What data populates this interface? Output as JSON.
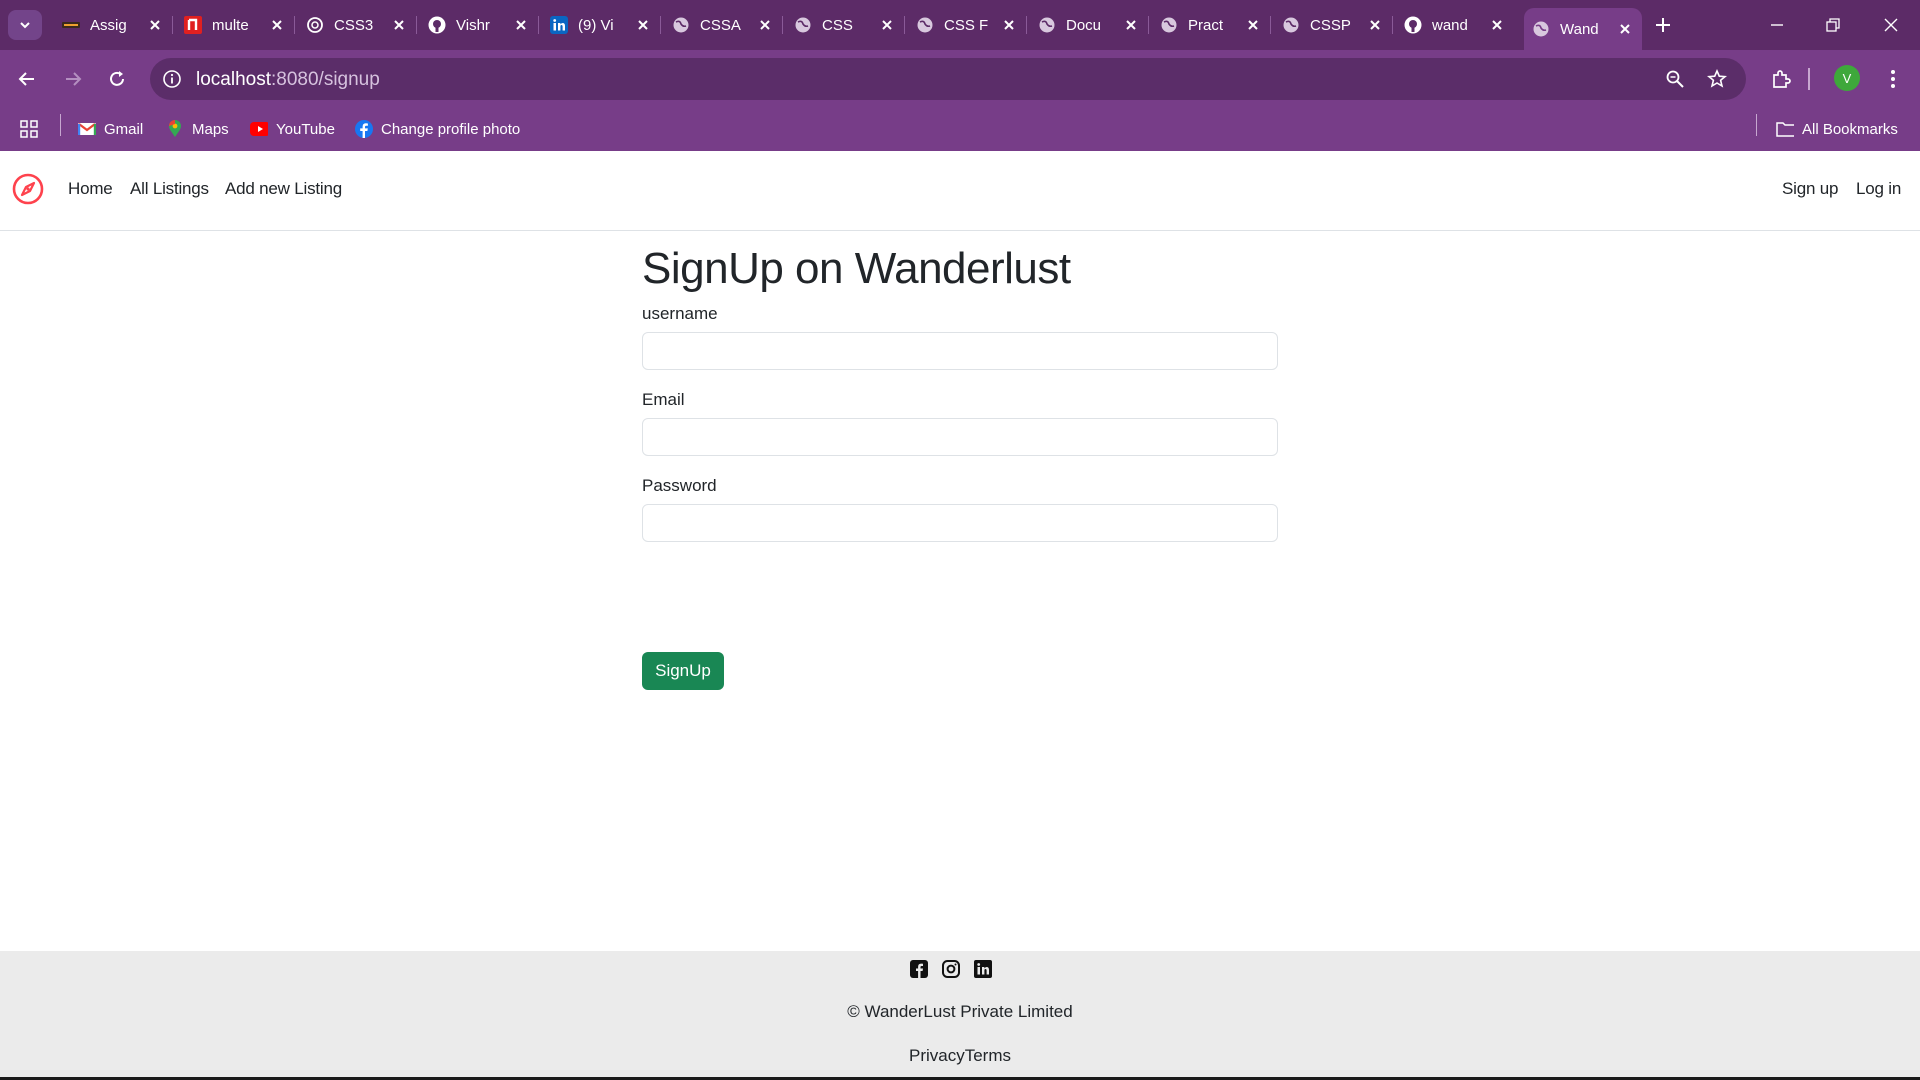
{
  "browser": {
    "tabs": [
      {
        "title": "Assig",
        "icon": "assignment-favicon-icon"
      },
      {
        "title": "multe",
        "icon": "red-favicon-icon"
      },
      {
        "title": "CSS3",
        "icon": "openai-favicon-icon"
      },
      {
        "title": "Vishr",
        "icon": "github-icon"
      },
      {
        "title": "(9) Vi",
        "icon": "linkedin-icon"
      },
      {
        "title": "CSSA",
        "icon": "globe-icon"
      },
      {
        "title": "CSS",
        "icon": "globe-icon"
      },
      {
        "title": "CSS F",
        "icon": "globe-icon"
      },
      {
        "title": "Docu",
        "icon": "globe-icon"
      },
      {
        "title": "Pract",
        "icon": "globe-icon"
      },
      {
        "title": "CSSP",
        "icon": "globe-icon"
      },
      {
        "title": "wand",
        "icon": "github-icon"
      },
      {
        "title": "Wand",
        "icon": "globe-icon",
        "active": true
      }
    ],
    "url_host": "localhost",
    "url_path": ":8080/signup",
    "profile_initial": "V",
    "bookmarks": [
      {
        "label": "Gmail",
        "icon": "gmail-icon"
      },
      {
        "label": "Maps",
        "icon": "maps-icon"
      },
      {
        "label": "YouTube",
        "icon": "youtube-icon"
      },
      {
        "label": "Change profile photo",
        "icon": "facebook-icon"
      }
    ],
    "all_bookmarks": "All Bookmarks",
    "colors": {
      "frame": "#5c2b67",
      "toolbar": "#773d88",
      "omnibox": "#5b2d69"
    }
  },
  "site": {
    "nav": {
      "links": [
        "Home",
        "All Listings",
        "Add new Listing"
      ],
      "right_links": [
        "Sign up",
        "Log in"
      ]
    },
    "form": {
      "title": "SignUp on Wanderlust",
      "fields": [
        {
          "label": "username",
          "value": ""
        },
        {
          "label": "Email",
          "value": ""
        },
        {
          "label": "Password",
          "value": ""
        }
      ],
      "submit": "SignUp"
    },
    "footer": {
      "social_icons": [
        "facebook-icon",
        "instagram-icon",
        "linkedin-icon"
      ],
      "copyright": "© WanderLust Private Limited",
      "links": [
        "Privacy",
        "Terms"
      ]
    },
    "colors": {
      "brand": "#fe424d",
      "submit": "#198754",
      "footer_bg": "#ebebeb"
    }
  }
}
